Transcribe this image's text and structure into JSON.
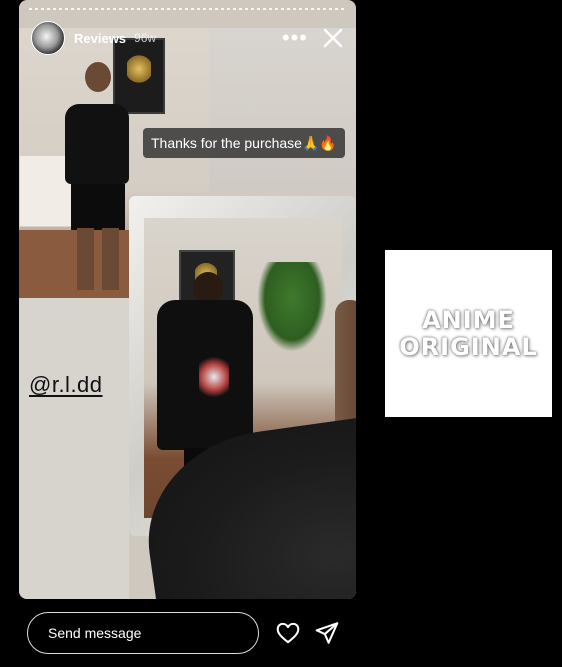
{
  "story": {
    "username": "Reviews",
    "time_ago": "96w",
    "more_icon": "more-horizontal-icon",
    "close_icon": "close-icon",
    "caption": "Thanks for the purchase🙏🔥",
    "mention": "@r.l.dd"
  },
  "reply_bar": {
    "placeholder": "Send message",
    "like_icon": "heart-icon",
    "share_icon": "send-icon"
  },
  "next_story": {
    "line1": "ANIME",
    "line2": "ORIGINAL"
  }
}
